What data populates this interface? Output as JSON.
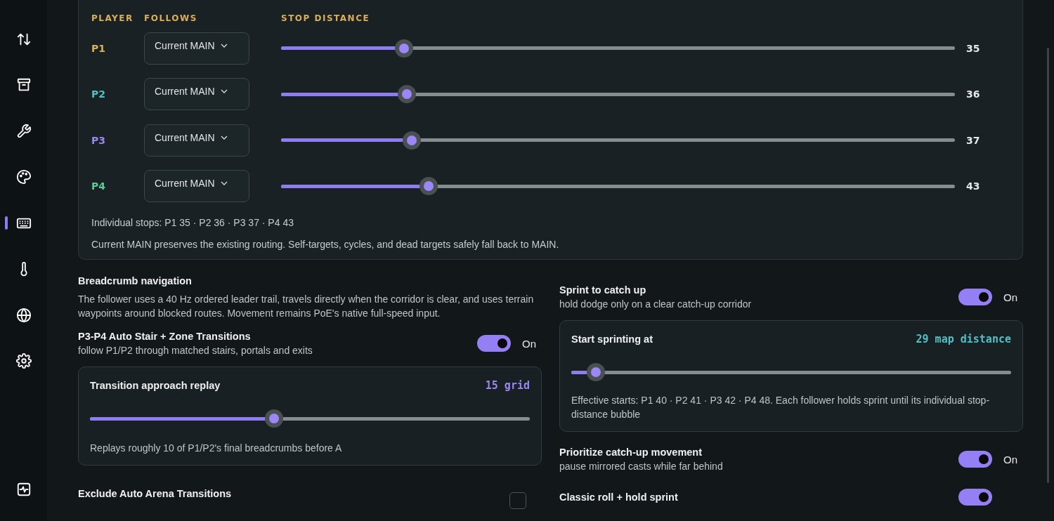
{
  "sidebar": {
    "items": [
      {
        "selected": false
      },
      {
        "selected": false
      },
      {
        "selected": false
      },
      {
        "selected": false
      },
      {
        "selected": true
      },
      {
        "selected": false
      },
      {
        "selected": false
      },
      {
        "selected": false
      }
    ]
  },
  "follow_table": {
    "columns": [
      "PLAYER",
      "FOLLOWS",
      "STOP DISTANCE"
    ],
    "rows": [
      {
        "player": "P1",
        "color": "#ddb052",
        "follows": "Current MAIN",
        "level": 0.182,
        "reading": "35"
      },
      {
        "player": "P2",
        "color": "#4fc1c6",
        "follows": "Current MAIN",
        "level": 0.187,
        "reading": "36"
      },
      {
        "player": "P3",
        "color": "#9b86f2",
        "follows": "Current MAIN",
        "level": 0.194,
        "reading": "37"
      },
      {
        "player": "P4",
        "color": "#5ccb98",
        "follows": "Current MAIN",
        "level": 0.219,
        "reading": "43"
      }
    ],
    "summary": "Individual stops: P1 35 · P2 36 · P3 37 · P4 43",
    "note": "Current MAIN preserves the existing routing. Self-targets, cycles, and dead targets safely fall back to MAIN."
  },
  "left_column": [
    {
      "kind": "info",
      "title": "Breadcrumb navigation",
      "text": "The follower uses a 40 Hz ordered leader trail, travels directly when the corridor is clear, and uses terrain waypoints around blocked routes. Movement remains PoE's native full-speed input."
    },
    {
      "kind": "toggle",
      "title": "P3-P4 Auto Stair + Zone Transitions",
      "subtitle": "follow P1/P2 through matched stairs, portals and exits",
      "on": true,
      "state_label": "On"
    },
    {
      "kind": "slider",
      "title": "Transition approach replay",
      "value": "15 grid",
      "level": 0.418,
      "text": "Replays roughly 10 of P1/P2's final breadcrumbs before A"
    },
    {
      "kind": "checkbox",
      "title": "Exclude Auto Arena Transitions",
      "checked": false
    }
  ],
  "right_column": [
    {
      "kind": "toggle",
      "title": "Sprint to catch up",
      "subtitle": "hold dodge only on a clear catch-up corridor",
      "on": true,
      "state_label": "On"
    },
    {
      "kind": "slider",
      "title": "Start sprinting at",
      "value": "29 map distance",
      "level": 0.056,
      "text": "Effective starts: P1 40 · P2 41 · P3 42 · P4 48. Each follower holds sprint until its individual stop-distance bubble"
    },
    {
      "kind": "toggle",
      "title": "Prioritize catch-up movement",
      "subtitle": "pause mirrored casts while far behind",
      "on": true,
      "state_label": "On"
    },
    {
      "kind": "toggle",
      "title": "Classic roll + hold sprint",
      "on": true
    }
  ]
}
